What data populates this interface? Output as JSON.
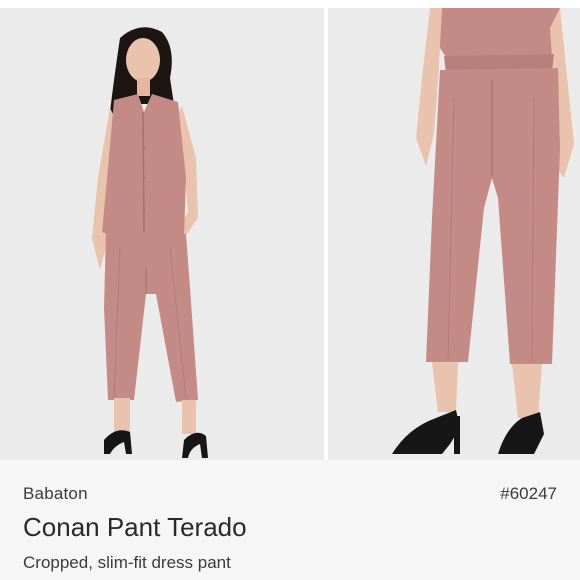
{
  "listing": {
    "brand": "Babaton",
    "sku": "#60247",
    "title": "Conan Pant Terado",
    "subtitle": "Cropped, slim-fit dress pant"
  },
  "colors": {
    "background": "#ebebeb",
    "garment_pink": "#c48b86",
    "garment_shadow": "#a96f6b",
    "skin": "#e9c3ad",
    "hair": "#1c1512",
    "shoe": "#161616",
    "text": "#2a2a2a"
  },
  "images": [
    {
      "name": "product-photo-full-outfit"
    },
    {
      "name": "product-photo-pants-detail"
    }
  ]
}
